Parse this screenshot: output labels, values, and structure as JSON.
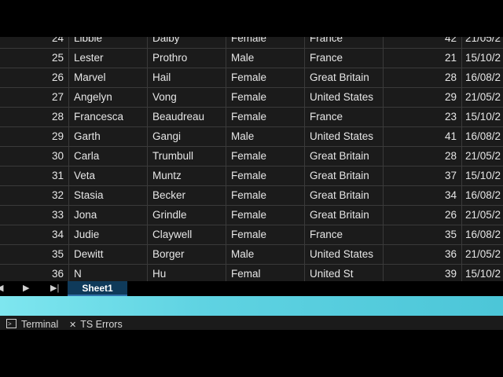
{
  "rows": [
    {
      "id": "24",
      "first": "Libbie",
      "last": "Dalby",
      "gender": "Female",
      "country": "France",
      "age": "42",
      "date": "21/05/2"
    },
    {
      "id": "25",
      "first": "Lester",
      "last": "Prothro",
      "gender": "Male",
      "country": "France",
      "age": "21",
      "date": "15/10/2"
    },
    {
      "id": "26",
      "first": "Marvel",
      "last": "Hail",
      "gender": "Female",
      "country": "Great Britain",
      "age": "28",
      "date": "16/08/2"
    },
    {
      "id": "27",
      "first": "Angelyn",
      "last": "Vong",
      "gender": "Female",
      "country": "United States",
      "age": "29",
      "date": "21/05/2"
    },
    {
      "id": "28",
      "first": "Francesca",
      "last": "Beaudreau",
      "gender": "Female",
      "country": "France",
      "age": "23",
      "date": "15/10/2"
    },
    {
      "id": "29",
      "first": "Garth",
      "last": "Gangi",
      "gender": "Male",
      "country": "United States",
      "age": "41",
      "date": "16/08/2"
    },
    {
      "id": "30",
      "first": "Carla",
      "last": "Trumbull",
      "gender": "Female",
      "country": "Great Britain",
      "age": "28",
      "date": "21/05/2"
    },
    {
      "id": "31",
      "first": "Veta",
      "last": "Muntz",
      "gender": "Female",
      "country": "Great Britain",
      "age": "37",
      "date": "15/10/2"
    },
    {
      "id": "32",
      "first": "Stasia",
      "last": "Becker",
      "gender": "Female",
      "country": "Great Britain",
      "age": "34",
      "date": "16/08/2"
    },
    {
      "id": "33",
      "first": "Jona",
      "last": "Grindle",
      "gender": "Female",
      "country": "Great Britain",
      "age": "26",
      "date": "21/05/2"
    },
    {
      "id": "34",
      "first": "Judie",
      "last": "Claywell",
      "gender": "Female",
      "country": "France",
      "age": "35",
      "date": "16/08/2"
    },
    {
      "id": "35",
      "first": "Dewitt",
      "last": "Borger",
      "gender": "Male",
      "country": "United States",
      "age": "36",
      "date": "21/05/2"
    },
    {
      "id": "36",
      "first": "N",
      "last": "Hu",
      "gender": "Femal",
      "country": "United St",
      "age": "39",
      "date": "15/10/2"
    }
  ],
  "sheet_tabs": {
    "active": "Sheet1",
    "next_icon": "triangle-right-icon",
    "last_icon": "skip-to-last-icon",
    "prev_icon": "triangle-left-icon"
  },
  "status": {
    "terminal": "Terminal",
    "ts_errors": "TS Errors"
  },
  "colors": {
    "grid_bg": "#1b1b1b",
    "active_tab": "#0f3a5a",
    "accent_bar": "#5fd3e2"
  }
}
